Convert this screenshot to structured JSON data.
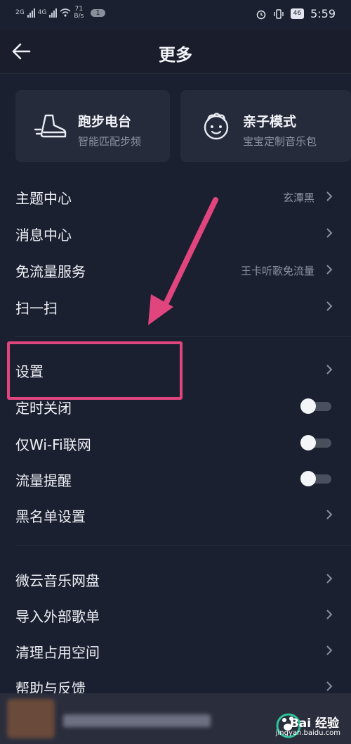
{
  "status_bar": {
    "network_1": "2G",
    "network_2": "4G",
    "speed_value": "71",
    "speed_unit": "B/s",
    "notification_count": "1",
    "battery": "46",
    "time": "5:59"
  },
  "header": {
    "title": "更多"
  },
  "cards": [
    {
      "title": "跑步电台",
      "subtitle": "智能匹配步频",
      "icon": "running-shoe-icon"
    },
    {
      "title": "亲子模式",
      "subtitle": "宝宝定制音乐包",
      "icon": "child-face-icon"
    }
  ],
  "list_group_1": [
    {
      "label": "主题中心",
      "value": "玄潭黑"
    },
    {
      "label": "消息中心",
      "value": ""
    },
    {
      "label": "免流量服务",
      "value": "王卡听歌免流量"
    },
    {
      "label": "扫一扫",
      "value": ""
    }
  ],
  "list_group_2": [
    {
      "label": "设置"
    },
    {
      "label": "定时关闭",
      "toggle": "off"
    },
    {
      "label": "仅Wi-Fi联网",
      "toggle": "off"
    },
    {
      "label": "流量提醒",
      "toggle": "off"
    },
    {
      "label": "黑名单设置"
    }
  ],
  "list_group_3": [
    {
      "label": "微云音乐网盘"
    },
    {
      "label": "导入外部歌单"
    },
    {
      "label": "清理占用空间"
    },
    {
      "label": "帮助与反馈"
    }
  ],
  "watermark": {
    "text": "Bai 经验",
    "sub": "jingyan.baidu.com"
  },
  "colors": {
    "background": "#1b2030",
    "card": "#262b3b",
    "annotation": "#e0457e"
  }
}
